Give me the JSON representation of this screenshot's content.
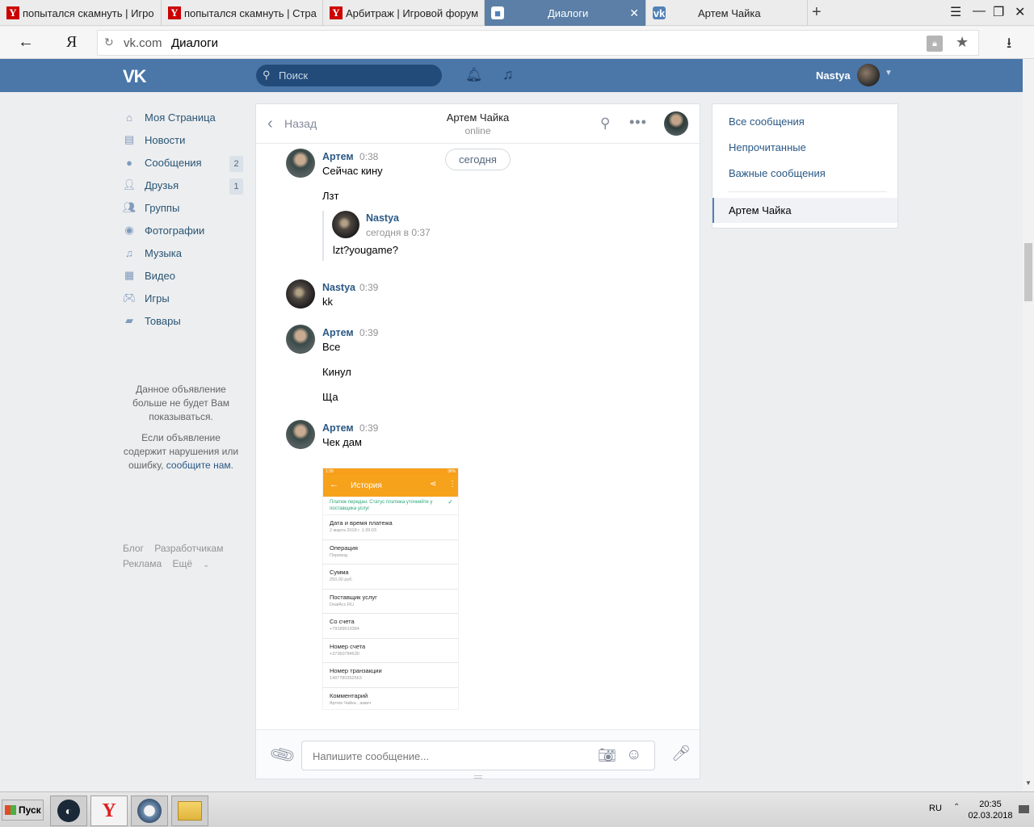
{
  "browser": {
    "tabs": [
      {
        "title": "попытался скамнуть | Игро",
        "icon": "yandex-favicon"
      },
      {
        "title": "попытался скамнуть | Стра",
        "icon": "yandex-favicon"
      },
      {
        "title": "Арбитраж | Игровой форум",
        "icon": "yandex-favicon"
      },
      {
        "title": "Диалоги",
        "icon": "vk-message-favicon",
        "active": true
      },
      {
        "title": "Артем Чайка",
        "icon": "vk-favicon"
      }
    ],
    "address": {
      "domain": "vk.com",
      "page": "Диалоги"
    },
    "ya_label": "Я"
  },
  "vk": {
    "logo": "VK",
    "search_placeholder": "Поиск",
    "user_name": "Nastya",
    "brand_color": "#4a76a8"
  },
  "nav": {
    "items": [
      {
        "label": "Моя Страница",
        "icon": "home-icon"
      },
      {
        "label": "Новости",
        "icon": "news-icon"
      },
      {
        "label": "Сообщения",
        "icon": "messages-icon",
        "badge": "2"
      },
      {
        "label": "Друзья",
        "icon": "friends-icon",
        "badge": "1"
      },
      {
        "label": "Группы",
        "icon": "groups-icon"
      },
      {
        "label": "Фотографии",
        "icon": "camera-icon"
      },
      {
        "label": "Музыка",
        "icon": "music-icon"
      },
      {
        "label": "Видео",
        "icon": "video-icon"
      },
      {
        "label": "Игры",
        "icon": "gamepad-icon"
      },
      {
        "label": "Товары",
        "icon": "bag-icon"
      }
    ]
  },
  "ad": {
    "line1": "Данное объявление больше не будет Вам показываться.",
    "line2_prefix": "Если объявление содержит нарушения или ошибку,",
    "line2_link": "сообщите нам",
    "line2_suffix": "."
  },
  "footer": {
    "blog": "Блог",
    "devs": "Разработчикам",
    "ads": "Реклама",
    "more": "Ещё"
  },
  "dialog": {
    "back": "Назад",
    "name": "Артем Чайка",
    "status": "online",
    "day": "сегодня",
    "messages": [
      {
        "author": "Артем",
        "time": "0:38",
        "lines": [
          "Сейчас кину",
          "Лзт"
        ]
      },
      {
        "forward": {
          "author": "Nastya",
          "date": "сегодня в 0:37",
          "text": "lzt?yougame?"
        }
      },
      {
        "author": "Nastya",
        "time": "0:39",
        "lines": [
          "kk"
        ]
      },
      {
        "author": "Артем",
        "time": "0:39",
        "lines": [
          "Все",
          "Кинул",
          "Ща"
        ]
      },
      {
        "author": "Артем",
        "time": "0:39",
        "lines": [
          "Чек дам"
        ]
      }
    ],
    "composer_placeholder": "Напишите сообщение..."
  },
  "receipt": {
    "title": "История",
    "banner": "Платеж передан. Статус платежа уточняйте у поставщика услуг",
    "rows": [
      {
        "label": "Дата и время платежа",
        "value": "2 марта 2018 г. 1:39:03"
      },
      {
        "label": "Операция",
        "value": "Перевод"
      },
      {
        "label": "Сумма",
        "value": "250,00 руб."
      },
      {
        "label": "Поставщик услуг",
        "value": "DealAcc.RU"
      },
      {
        "label": "Со счета",
        "value": "+79189019384"
      },
      {
        "label": "Номер счета",
        "value": "+37360784630"
      },
      {
        "label": "Номер транзакции",
        "value": "1487780352563"
      },
      {
        "label": "Комментарий",
        "value": "Артем Чайка , аккич"
      }
    ],
    "accent": "#f7a21b"
  },
  "rightmenu": {
    "all": "Все сообщения",
    "unread": "Непрочитанные",
    "important": "Важные сообщения",
    "active": "Артем Чайка"
  },
  "taskbar": {
    "start": "Пуск",
    "lang": "RU",
    "time": "20:35",
    "date": "02.03.2018"
  }
}
